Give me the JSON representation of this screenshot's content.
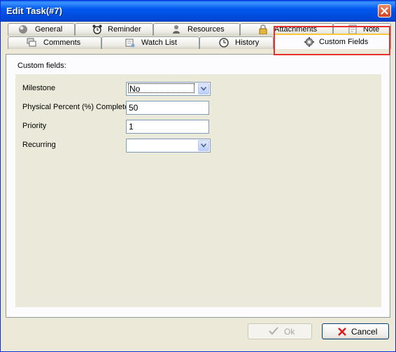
{
  "window": {
    "title": "Edit Task(#7)"
  },
  "tabs_row1": [
    {
      "label": "General",
      "icon": "general-icon"
    },
    {
      "label": "Reminder",
      "icon": "alarm-clock-icon"
    },
    {
      "label": "Resources",
      "icon": "users-icon"
    },
    {
      "label": "Attachments",
      "icon": "lock-icon"
    },
    {
      "label": "Note",
      "icon": "note-icon"
    }
  ],
  "tabs_row2": [
    {
      "label": "Comments",
      "icon": "comments-icon"
    },
    {
      "label": "Watch List",
      "icon": "watch-list-icon"
    },
    {
      "label": "History",
      "icon": "history-icon"
    },
    {
      "label": "Custom Fields",
      "icon": "gear-icon",
      "active": true
    }
  ],
  "panel": {
    "label": "Custom fields:",
    "fields": [
      {
        "label": "Milestone",
        "type": "select",
        "value": "No"
      },
      {
        "label": "Physical Percent (%) Complete",
        "type": "text",
        "value": "50"
      },
      {
        "label": "Priority",
        "type": "text",
        "value": "1"
      },
      {
        "label": "Recurring",
        "type": "select",
        "value": ""
      }
    ]
  },
  "buttons": {
    "ok": "Ok",
    "cancel": "Cancel"
  },
  "colors": {
    "title_bar": "#0054e3",
    "active_tab_accent": "#ffc73c",
    "highlight": "#e8312c",
    "cancel_icon": "#d81e1e"
  }
}
